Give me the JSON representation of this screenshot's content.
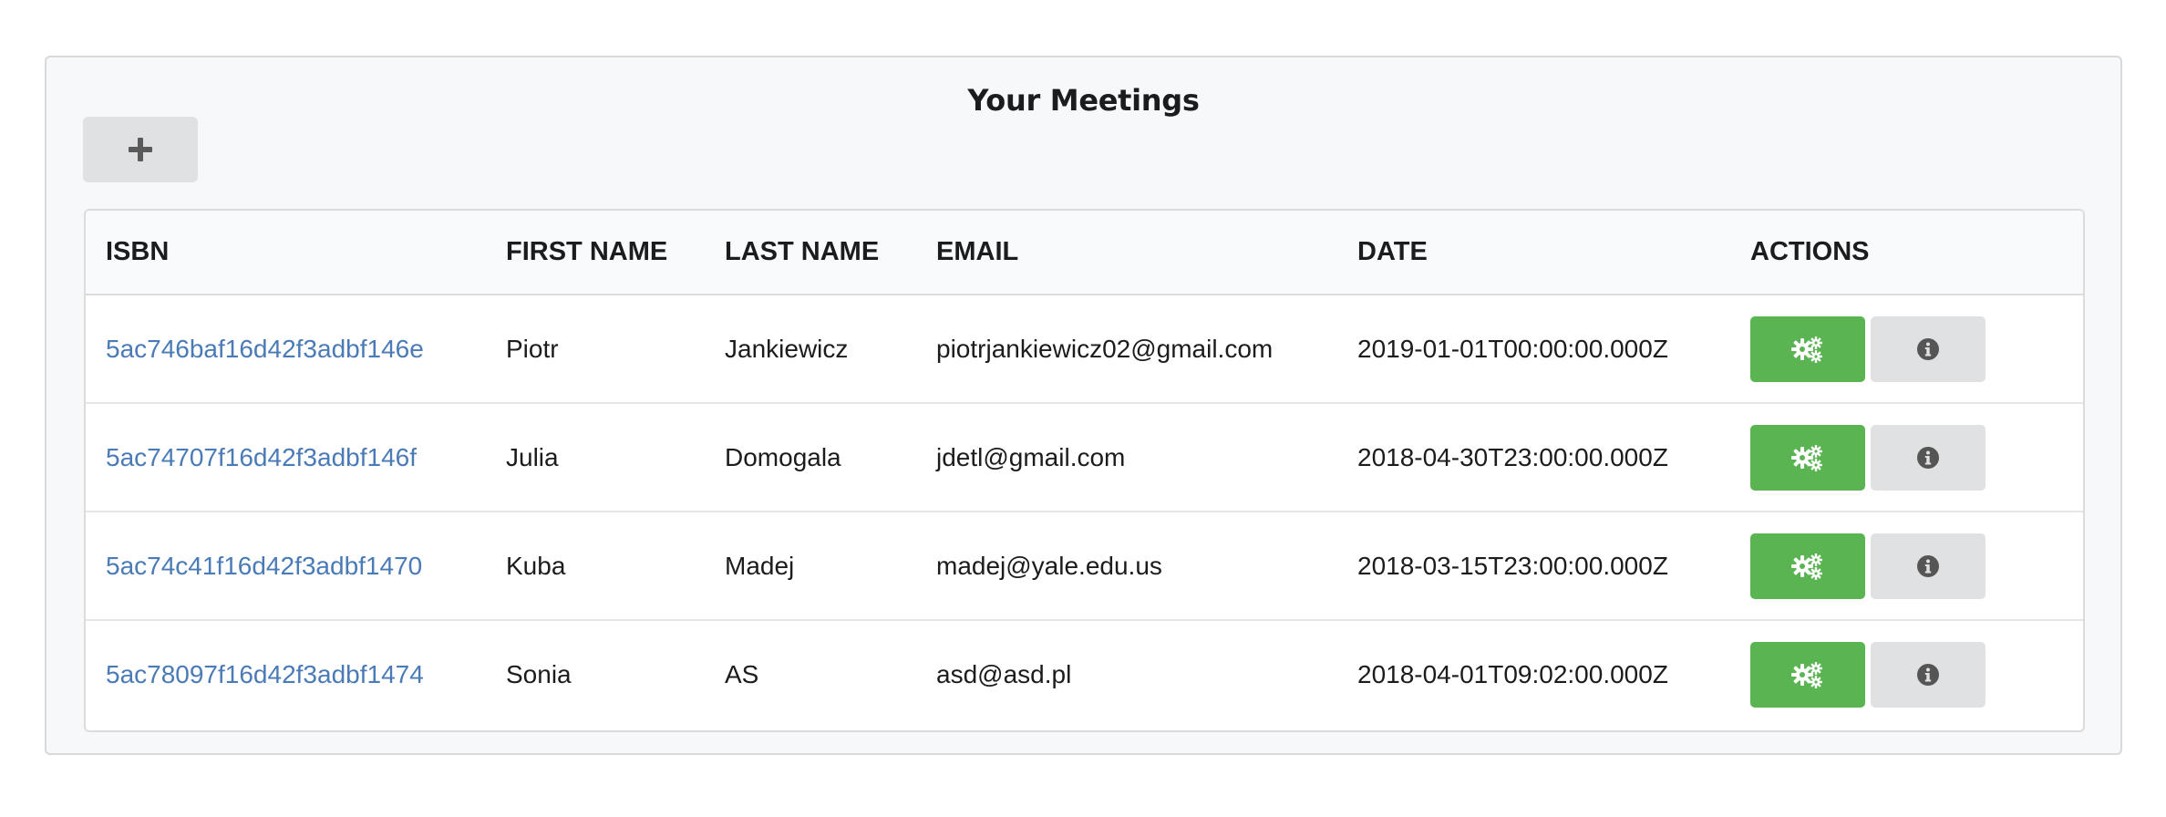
{
  "header": {
    "title": "Your Meetings",
    "add_button_icon": "plus-icon"
  },
  "table": {
    "columns": [
      "ISBN",
      "FIRST NAME",
      "LAST NAME",
      "EMAIL",
      "DATE",
      "ACTIONS"
    ],
    "rows": [
      {
        "isbn": "5ac746baf16d42f3adbf146e",
        "first_name": "Piotr",
        "last_name": "Jankiewicz",
        "email": "piotrjankiewicz02@gmail.com",
        "date": "2019-01-01T00:00:00.000Z"
      },
      {
        "isbn": "5ac74707f16d42f3adbf146f",
        "first_name": "Julia",
        "last_name": "Domogala",
        "email": "jdetl@gmail.com",
        "date": "2018-04-30T23:00:00.000Z"
      },
      {
        "isbn": "5ac74c41f16d42f3adbf1470",
        "first_name": "Kuba",
        "last_name": "Madej",
        "email": "madej@yale.edu.us",
        "date": "2018-03-15T23:00:00.000Z"
      },
      {
        "isbn": "5ac78097f16d42f3adbf1474",
        "first_name": "Sonia",
        "last_name": "AS",
        "email": "asd@asd.pl",
        "date": "2018-04-01T09:02:00.000Z"
      }
    ],
    "actions": {
      "settings_icon": "cogs-icon",
      "info_icon": "info-circle-icon"
    }
  },
  "colors": {
    "link": "#4a7bb7",
    "settings_button": "#5ab452",
    "info_button": "#e0e1e2",
    "panel_background": "#f7f8f9"
  }
}
